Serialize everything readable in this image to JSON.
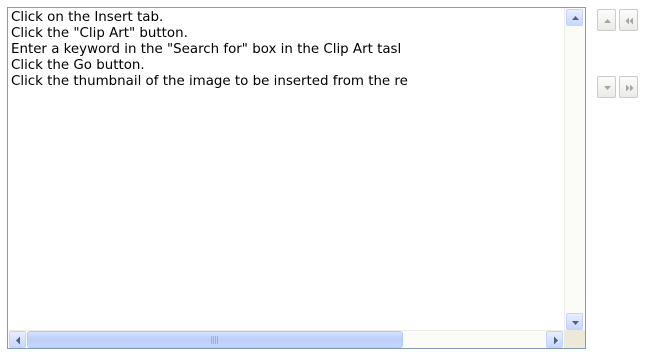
{
  "steps_list": {
    "lines": [
      "Click on the Insert tab.",
      "Click the \"Clip Art\" button.",
      "Enter a keyword in the \"Search for\" box in the Clip Art tasl",
      "Click the Go button.",
      "Click the thumbnail of the image to be inserted from the re"
    ]
  },
  "scrollbars": {
    "horizontal_grip_glyph": "III"
  },
  "icons": {
    "scroll_up": "triangle-up-icon",
    "scroll_down": "triangle-down-icon",
    "scroll_left": "triangle-left-icon",
    "scroll_right": "triangle-right-icon",
    "move_up": "move-up-icon",
    "move_down": "move-down-icon",
    "move_first": "move-to-top-icon",
    "move_last": "move-to-bottom-icon"
  },
  "colors": {
    "border": "#7f9db9",
    "scroll_button": "#c6d6fc",
    "arrow": "#4d6185",
    "side_arrow": "#a5a5a5"
  }
}
